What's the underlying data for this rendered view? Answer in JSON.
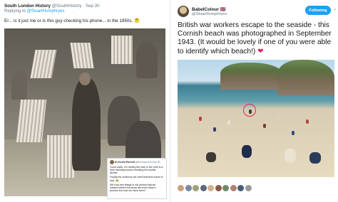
{
  "left_tweet": {
    "name": "South London History",
    "handle": "@SouthHistory",
    "date": "Sep 30",
    "reply_prefix": "Replying to",
    "reply_handle": "@StuartHumphryes",
    "text": "Er... is it just me or is this guy checking his phone... in the 1950s. 🤔"
  },
  "reply_card": {
    "name": "Dr Kevin Purcell",
    "handle": "@kevinpurcell",
    "date": "Sep 30",
    "line1": "Good catch. It's clearly the man in the shot is a time traveling tourist checking his mobile device.",
    "line2": "Finally the evidence we need that time travel is real. 😂",
    "line3": "We now see things in old photos that we missed before but know we know they're phones but now we have them!"
  },
  "right_tweet": {
    "name": "BabelColour",
    "flag": "🇬🇧",
    "handle": "@StuartHumphryes",
    "follow_label": "Following",
    "chevron": "⌄",
    "text": "British war workers escape to the seaside - this Cornish beach was photographed in September 1943. (It would be lovely if one of you were able to identify which beach!)",
    "heart": "❤"
  },
  "colors": {
    "accent": "#1da1f2",
    "heart": "#e0245e"
  }
}
